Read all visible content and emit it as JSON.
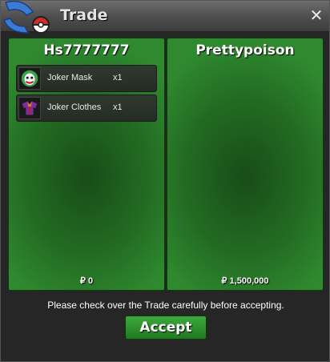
{
  "window": {
    "title": "Trade",
    "close_label": "✕"
  },
  "left_panel": {
    "player_name": "Hs7777777",
    "items": [
      {
        "name": "Joker Mask",
        "qty": "x1",
        "icon": "joker-mask-icon"
      },
      {
        "name": "Joker Clothes",
        "qty": "x1",
        "icon": "joker-clothes-icon"
      }
    ],
    "money": "₽ 0"
  },
  "right_panel": {
    "player_name": "Prettypoison",
    "items": [],
    "money": "₽ 1,500,000"
  },
  "notice": "Please check over the Trade carefully before accepting.",
  "accept_label": "Accept",
  "colors": {
    "panel_green": "#226a22",
    "accept_green": "#2f8f2f",
    "titlebar": "#555555"
  }
}
